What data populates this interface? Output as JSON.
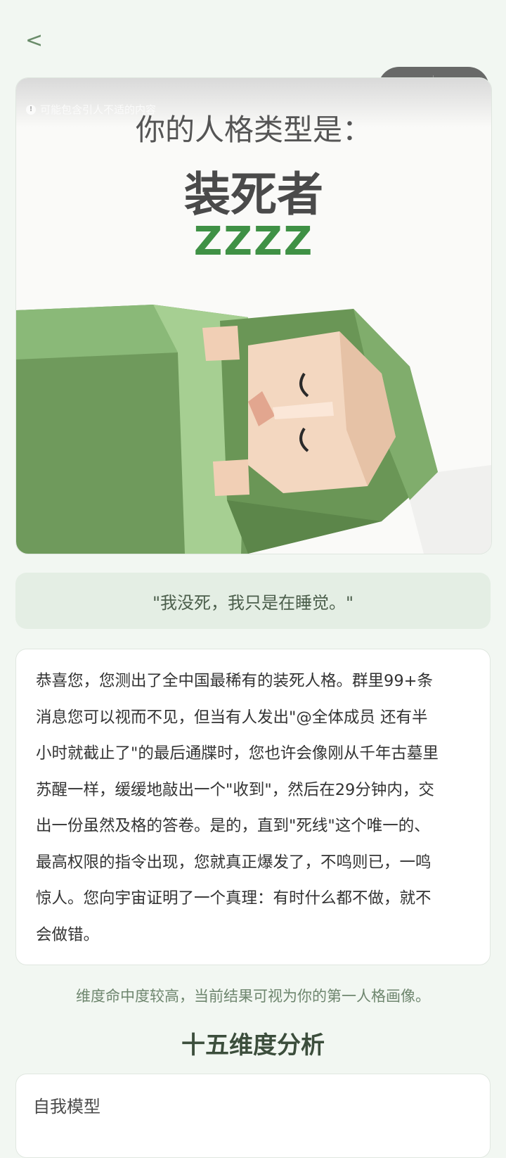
{
  "nav": {
    "back_label": "<"
  },
  "capsule": {
    "more_icon": "more-dots-icon",
    "close_icon": "target-close-icon"
  },
  "hero": {
    "warning": "可能包含引人不适的内容",
    "subtitle": "你的人格类型是：",
    "type_name": "装死者",
    "zzz": "ZZZZ",
    "palette": {
      "green_dark": "#6f9a5c",
      "green_light": "#a6cf92",
      "skin": "#f3d7c0",
      "text_green": "#3f9145"
    }
  },
  "quote": "\"我没死，我只是在睡觉。\"",
  "description": "恭喜您，您测出了全中国最稀有的装死人格。群里99+条消息您可以视而不见，但当有人发出\"@全体成员 还有半小时就截止了\"的最后通牒时，您也许会像刚从千年古墓里苏醒一样，缓缓地敲出一个\"收到\"，然后在29分钟内，交出一份虽然及格的答卷。是的，直到\"死线\"这个唯一的、最高权限的指令出现，您就真正爆发了，不鸣则已，一鸣惊人。您向宇宙证明了一个真理：有时什么都不做，就不会做错。",
  "note": "维度命中度较高，当前结果可视为你的第一人格画像。",
  "section_title": "十五维度分析",
  "dimensions": [
    {
      "name": "自我模型"
    }
  ]
}
